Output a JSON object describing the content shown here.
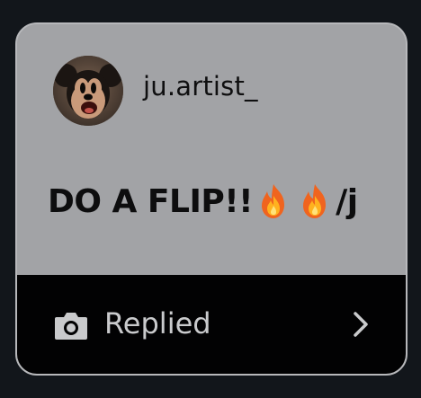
{
  "post": {
    "username": "ju.artist_",
    "message": "DO A FLIP!!",
    "message_suffix": "/j",
    "emoji": [
      "fire",
      "fire"
    ]
  },
  "footer": {
    "status_label": "Replied",
    "icon": "camera-icon",
    "action_icon": "chevron-right-icon"
  },
  "colors": {
    "page_background": "#12161b",
    "card_background": "#a2a3a6",
    "footer_background": "#020203",
    "footer_text": "#c9cacc"
  }
}
